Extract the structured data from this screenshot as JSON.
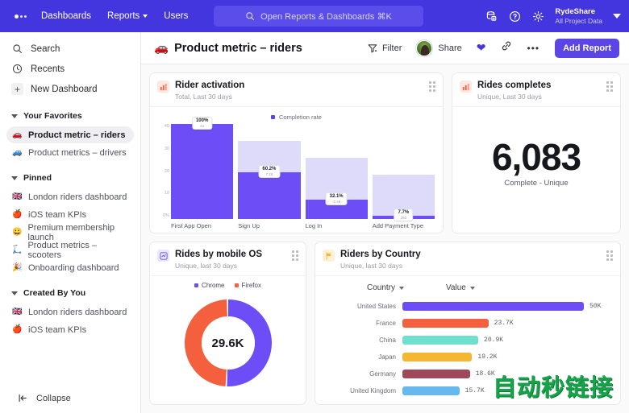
{
  "topnav": {
    "links": [
      {
        "label": "Dashboards",
        "caret": false
      },
      {
        "label": "Reports",
        "caret": true
      },
      {
        "label": "Users",
        "caret": false
      }
    ],
    "search_placeholder": "Open Reports &  Dashboards ⌘K",
    "icons": [
      "database-icon",
      "help-circle-icon",
      "gear-icon"
    ],
    "org_name": "RydeShare",
    "org_scope": "All Project Data"
  },
  "sidebar": {
    "top_items": [
      {
        "label": "Search",
        "icon": "search-icon"
      },
      {
        "label": "Recents",
        "icon": "clock-icon"
      },
      {
        "label": "New Dashboard",
        "icon": "plus-icon"
      }
    ],
    "sections": [
      {
        "title": "Your Favorites",
        "items": [
          {
            "label": "Product metric – riders",
            "emoji": "🚗",
            "active": true
          },
          {
            "label": "Product metrics – drivers",
            "emoji": "🚙",
            "active": false
          }
        ]
      },
      {
        "title": "Pinned",
        "items": [
          {
            "label": "London riders dashboard",
            "emoji": "🇬🇧",
            "active": false
          },
          {
            "label": "iOS team KPIs",
            "emoji": "🍎",
            "active": false
          },
          {
            "label": "Premium membership launch",
            "emoji": "😀",
            "active": false
          },
          {
            "label": "Product metrics – scooters",
            "emoji": "🛴",
            "active": false
          },
          {
            "label": "Onboarding dashboard",
            "emoji": "🎉",
            "active": false
          }
        ]
      },
      {
        "title": "Created By You",
        "items": [
          {
            "label": "London riders dashboard",
            "emoji": "🇬🇧",
            "active": false
          },
          {
            "label": "iOS team KPIs",
            "emoji": "🍎",
            "active": false
          }
        ]
      }
    ],
    "collapse_label": "Collapse"
  },
  "page_header": {
    "emoji": "🚗",
    "title": "Product metric – riders",
    "filter_label": "Filter",
    "share_label": "Share",
    "add_report_label": "Add Report"
  },
  "cards": {
    "rider_activation": {
      "title": "Rider activation",
      "subtitle": "Total, Last 30 days"
    },
    "rides_completes": {
      "title": "Rides completes",
      "subtitle": "Unique, Last 30 days",
      "value": "6,083",
      "caption": "Complete - Unique"
    },
    "rides_by_os": {
      "title": "Rides by mobile OS",
      "subtitle": "Unique, last 30 days"
    },
    "riders_by_country": {
      "title": "Riders by Country",
      "subtitle": "Unique, last 30 days",
      "col_country": "Country",
      "col_value": "Value"
    }
  },
  "watermark": "自动秒链接",
  "chart_data": [
    {
      "type": "bar",
      "id": "rider-activation-funnel",
      "title": "Rider activation",
      "subtitle": "Total, Last 30 days",
      "legend": [
        "Completion rate"
      ],
      "legend_position": "top-center",
      "categories": [
        "First App Open",
        "Sign Up",
        "Log In",
        "Add Payment Type"
      ],
      "values": [
        100,
        60.2,
        32.1,
        7.7
      ],
      "value_labels": [
        "100%",
        "60.2%",
        "32.1%",
        "7.7%"
      ],
      "sub_labels": [
        "44",
        "7.28",
        "-2.46",
        "282"
      ],
      "ylabel": "",
      "ytick_labels": [
        "40",
        "30",
        "20",
        "10",
        "0%"
      ],
      "ylim": [
        0,
        40
      ],
      "grid": false,
      "bar_color": "#6C4DF6",
      "track_color": "#DEDAFA"
    },
    {
      "type": "pie",
      "id": "rides-by-mobile-os",
      "title": "Rides by mobile OS",
      "subtitle": "Unique, last 30 days",
      "center_label": "29.6K",
      "labels": [
        "Chrome",
        "Firefox"
      ],
      "values": [
        51,
        49
      ],
      "colors": [
        "#6C4DF6",
        "#F4603E"
      ],
      "legend_position": "top-center"
    },
    {
      "type": "bar",
      "id": "riders-by-country",
      "title": "Riders by Country",
      "subtitle": "Unique, last 30 days",
      "orientation": "horizontal",
      "categories": [
        "United States",
        "France",
        "China",
        "Japan",
        "Germany",
        "United Kingdom"
      ],
      "values": [
        50,
        23.7,
        20.9,
        19.2,
        18.6,
        15.7
      ],
      "value_labels": [
        "50K",
        "23.7K",
        "20.9K",
        "19.2K",
        "18.6K",
        "15.7K"
      ],
      "colors": [
        "#6C4DF6",
        "#F4603E",
        "#6FE0CE",
        "#F5B731",
        "#A04759",
        "#66B8EF"
      ],
      "xlim": [
        0,
        50
      ],
      "grid": false
    }
  ]
}
